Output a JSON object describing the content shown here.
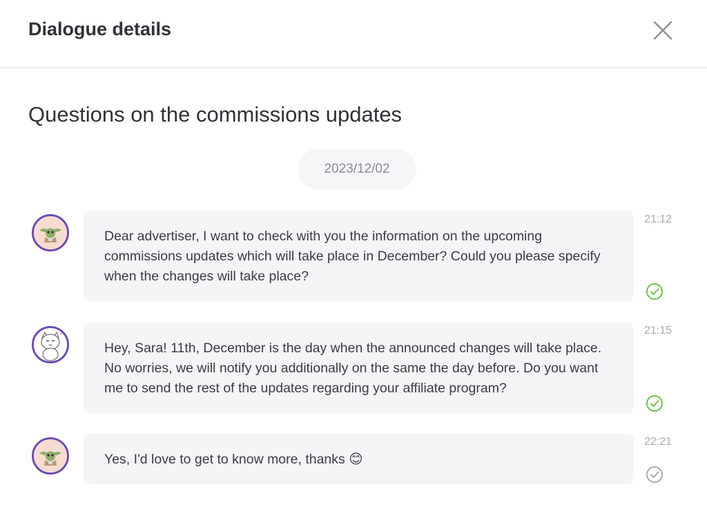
{
  "header": {
    "title": "Dialogue details"
  },
  "subject": "Questions on the commissions updates",
  "date_pill": "2023/12/02",
  "messages": [
    {
      "avatar": "yoda-avatar",
      "text": "Dear advertiser, I want to check with you the information on the upcoming commissions updates which will take place in December? Could you please specify when the changes will take place?",
      "time": "21:12",
      "status": "read",
      "status_color": "#6cc04a"
    },
    {
      "avatar": "cat-avatar",
      "text": "Hey, Sara! 11th, December is the day when the announced changes will take place. No worries, we will notify you additionally on the same the day before. Do you want me to send the rest of the updates regarding your affiliate program?",
      "time": "21:15",
      "status": "read",
      "status_color": "#6cc04a"
    },
    {
      "avatar": "yoda-avatar",
      "text": "Yes, I'd love to get to know more, thanks 😊",
      "time": "22:21",
      "status": "sent",
      "status_color": "#a6a9ad"
    }
  ],
  "icons": {
    "close": "close-icon",
    "check": "check-circle-icon"
  },
  "colors": {
    "avatar_border": "#6d4bb0",
    "bubble_bg": "#f5f5f7",
    "read_check": "#6cc04a",
    "unread_check": "#a6a9ad"
  }
}
